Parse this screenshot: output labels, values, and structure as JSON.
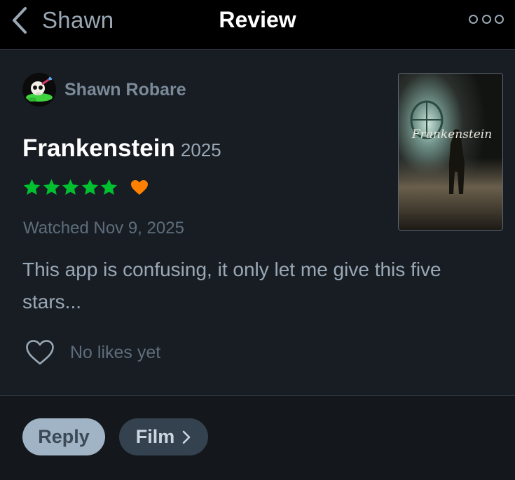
{
  "header": {
    "back_label": "Shawn",
    "title": "Review"
  },
  "review": {
    "author": "Shawn Robare",
    "film_title": "Frankenstein",
    "film_year": "2025",
    "rating_stars": 5,
    "liked": true,
    "watched": "Watched Nov 9, 2025",
    "text": "This app is confusing, it only let me give this five stars...",
    "likes_text": "No likes yet",
    "poster_text": "Frankenstein"
  },
  "actions": {
    "reply_label": "Reply",
    "film_label": "Film"
  },
  "colors": {
    "star_green": "#00c030",
    "heart_orange": "#ff8000",
    "background": "#181d23",
    "header_bg": "#000000"
  },
  "icons": [
    "chevron-left-icon",
    "more-icon",
    "star-icon",
    "heart-icon",
    "heart-outline-icon",
    "chevron-right-icon"
  ]
}
